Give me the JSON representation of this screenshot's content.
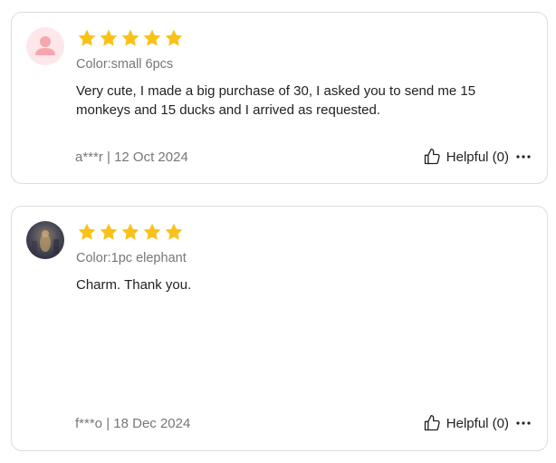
{
  "reviews": [
    {
      "rating": 5,
      "variant": "Color:small 6pcs",
      "text": "Very cute, I made a big purchase of 30, I asked you to send me 15 monkeys and 15 ducks and I arrived as requested.",
      "author_date": "a***r | 12 Oct 2024",
      "helpful_label": "Helpful (0)",
      "avatar": "default-avatar-icon"
    },
    {
      "rating": 5,
      "variant": "Color:1pc elephant",
      "text": "Charm. Thank you.",
      "author_date": "f***o | 18 Dec 2024",
      "helpful_label": "Helpful (0)",
      "avatar": "user-photo"
    }
  ],
  "colors": {
    "star": "#f9c21a",
    "border": "#dcdcdc",
    "muted_text": "#777777",
    "default_avatar_bg": "#fde7ea",
    "default_avatar_fg": "#f7a6af"
  },
  "icons": {
    "star": "star-icon",
    "helpful": "thumbs-up-icon",
    "more": "more-horizontal-icon"
  }
}
